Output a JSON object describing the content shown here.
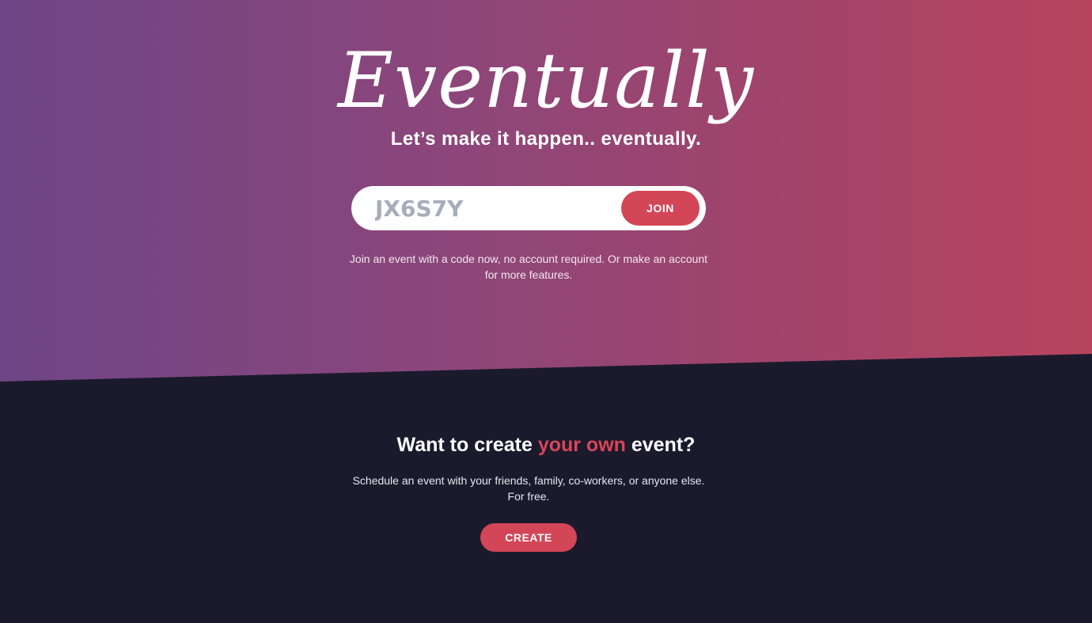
{
  "hero": {
    "logo": "Eventually",
    "tagline": "Let’s make it happen.. eventually.",
    "join": {
      "code_value": "JX6S7Y",
      "button_label": "JOIN"
    },
    "helper_text": "Join an event with a code now, no account required. Or make an account for more features."
  },
  "create": {
    "title_before": "Want to create ",
    "title_accent": "your own",
    "title_after": " event?",
    "description": "Schedule an event with your friends, family, co-workers, or anyone else. For free.",
    "button_label": "CREATE"
  },
  "colors": {
    "gradient_start": "#6e4586",
    "gradient_end": "#b8445e",
    "accent": "#d34657",
    "dark_background": "#1b1a2c"
  }
}
